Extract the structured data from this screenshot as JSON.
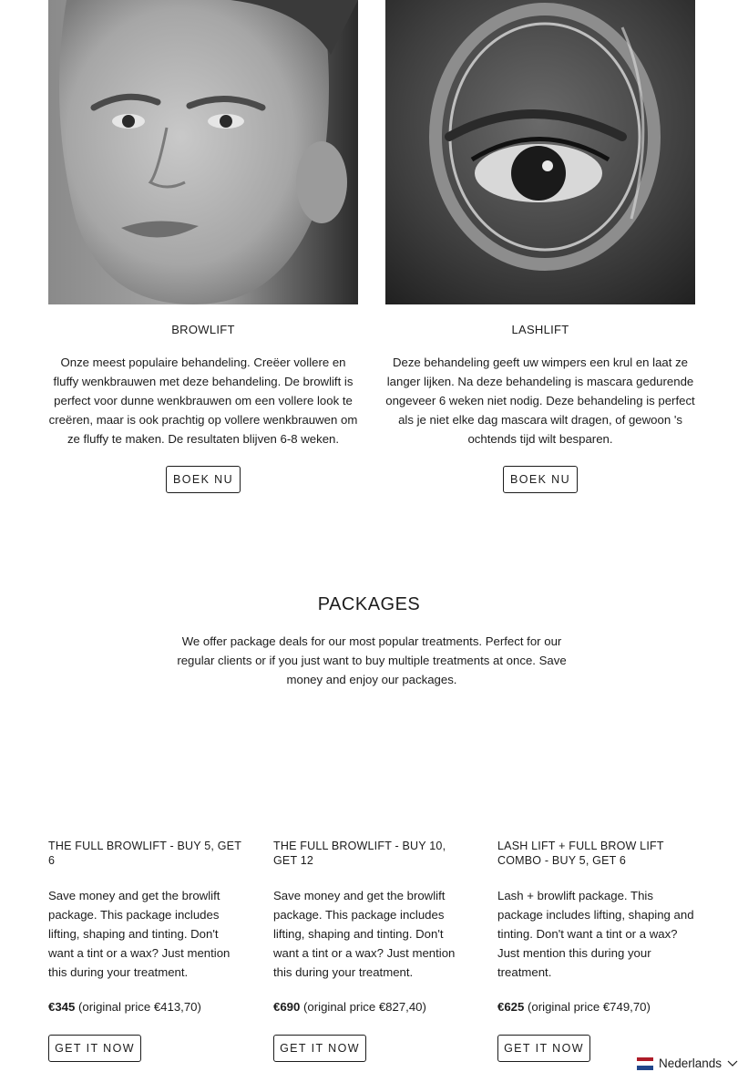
{
  "treatments": [
    {
      "title": "BROWLIFT",
      "description": "Onze meest populaire behandeling. Creëer vollere en fluffy wenkbrauwen met deze behandeling. De browlift is perfect voor dunne wenkbrauwen om een vollere look te creëren, maar is ook prachtig op vollere wenkbrauwen om ze fluffy te maken. De resultaten blijven 6-8 weken.",
      "button": "BOEK NU"
    },
    {
      "title": "LASHLIFT",
      "description": "Deze behandeling geeft uw wimpers een krul en laat ze langer lijken. Na deze behandeling is mascara gedurende ongeveer 6 weken niet nodig. Deze behandeling is perfect als je niet elke dag mascara wilt dragen, of gewoon 's ochtends tijd wilt besparen.",
      "button": "BOEK NU"
    }
  ],
  "packages_section": {
    "heading": "PACKAGES",
    "intro": "We offer package deals for our most popular treatments. Perfect for our regular clients or if you just want to buy multiple treatments at once. Save money and enjoy our packages."
  },
  "packages": [
    {
      "title": "THE FULL BROWLIFT - BUY 5, GET 6",
      "description": "Save money and get the browlift package. This package includes lifting, shaping and tinting. Don't want a tint or a wax? Just mention this during your treatment.",
      "price": "€345",
      "original": "(original price €413,70)",
      "button": "GET IT NOW"
    },
    {
      "title": "THE FULL BROWLIFT - BUY 10, GET 12",
      "description": "Save money and get the browlift package. This package includes lifting, shaping and tinting. Don't want a tint or a wax? Just mention this during your treatment.",
      "price": "€690",
      "original": "(original price €827,40)",
      "button": "GET IT NOW"
    },
    {
      "title": "LASH LIFT + FULL BROW LIFT COMBO - BUY 5, GET 6",
      "description": "Lash + browlift package. This package includes lifting, shaping and tinting. Don't want a tint or a wax? Just mention this during your treatment.",
      "price": "€625",
      "original": "(original price €749,70)",
      "button": "GET IT NOW"
    }
  ],
  "language_selector": {
    "label": "Nederlands",
    "flag_colors": [
      "#ae1c28",
      "#ffffff",
      "#21468b"
    ]
  }
}
